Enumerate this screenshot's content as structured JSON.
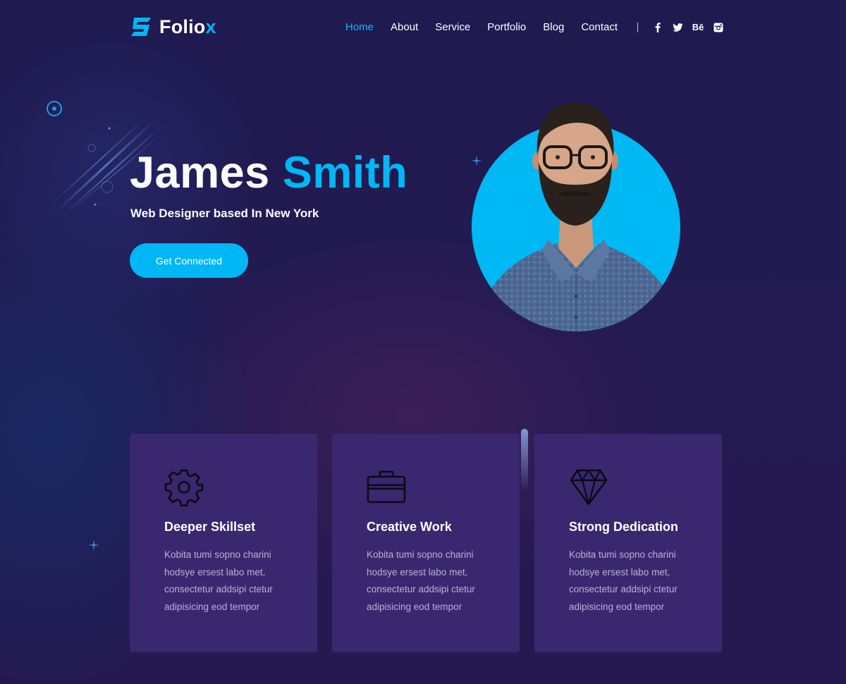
{
  "brand": {
    "name_main": "Folio",
    "name_accent": "x"
  },
  "nav": {
    "items": [
      {
        "label": "Home",
        "active": true
      },
      {
        "label": "About",
        "active": false
      },
      {
        "label": "Service",
        "active": false
      },
      {
        "label": "Portfolio",
        "active": false
      },
      {
        "label": "Blog",
        "active": false
      },
      {
        "label": "Contact",
        "active": false
      }
    ],
    "social": [
      "facebook-icon",
      "twitter-icon",
      "behance-icon",
      "instagram-icon"
    ],
    "behance_label": "Bē"
  },
  "hero": {
    "first_name": "James",
    "last_name": "Smith",
    "subtitle": "Web Designer based In New York",
    "cta_label": "Get Connected"
  },
  "features": [
    {
      "icon": "gear-icon",
      "title": "Deeper Skillset",
      "body": "Kobita tumi sopno charini hodsye ersest labo met, consectetur addsipi ctetur adipisicing eod tempor"
    },
    {
      "icon": "briefcase-icon",
      "title": "Creative Work",
      "body": "Kobita tumi sopno charini hodsye ersest labo met, consectetur addsipi ctetur adipisicing eod tempor"
    },
    {
      "icon": "diamond-icon",
      "title": "Strong Dedication",
      "body": "Kobita tumi sopno charini hodsye ersest labo met, consectetur addsipi ctetur adipisicing eod tempor"
    }
  ],
  "colors": {
    "accent": "#00b7f5",
    "background": "#211a4e",
    "card": "#39286f",
    "card_text": "#b9b1d6"
  }
}
